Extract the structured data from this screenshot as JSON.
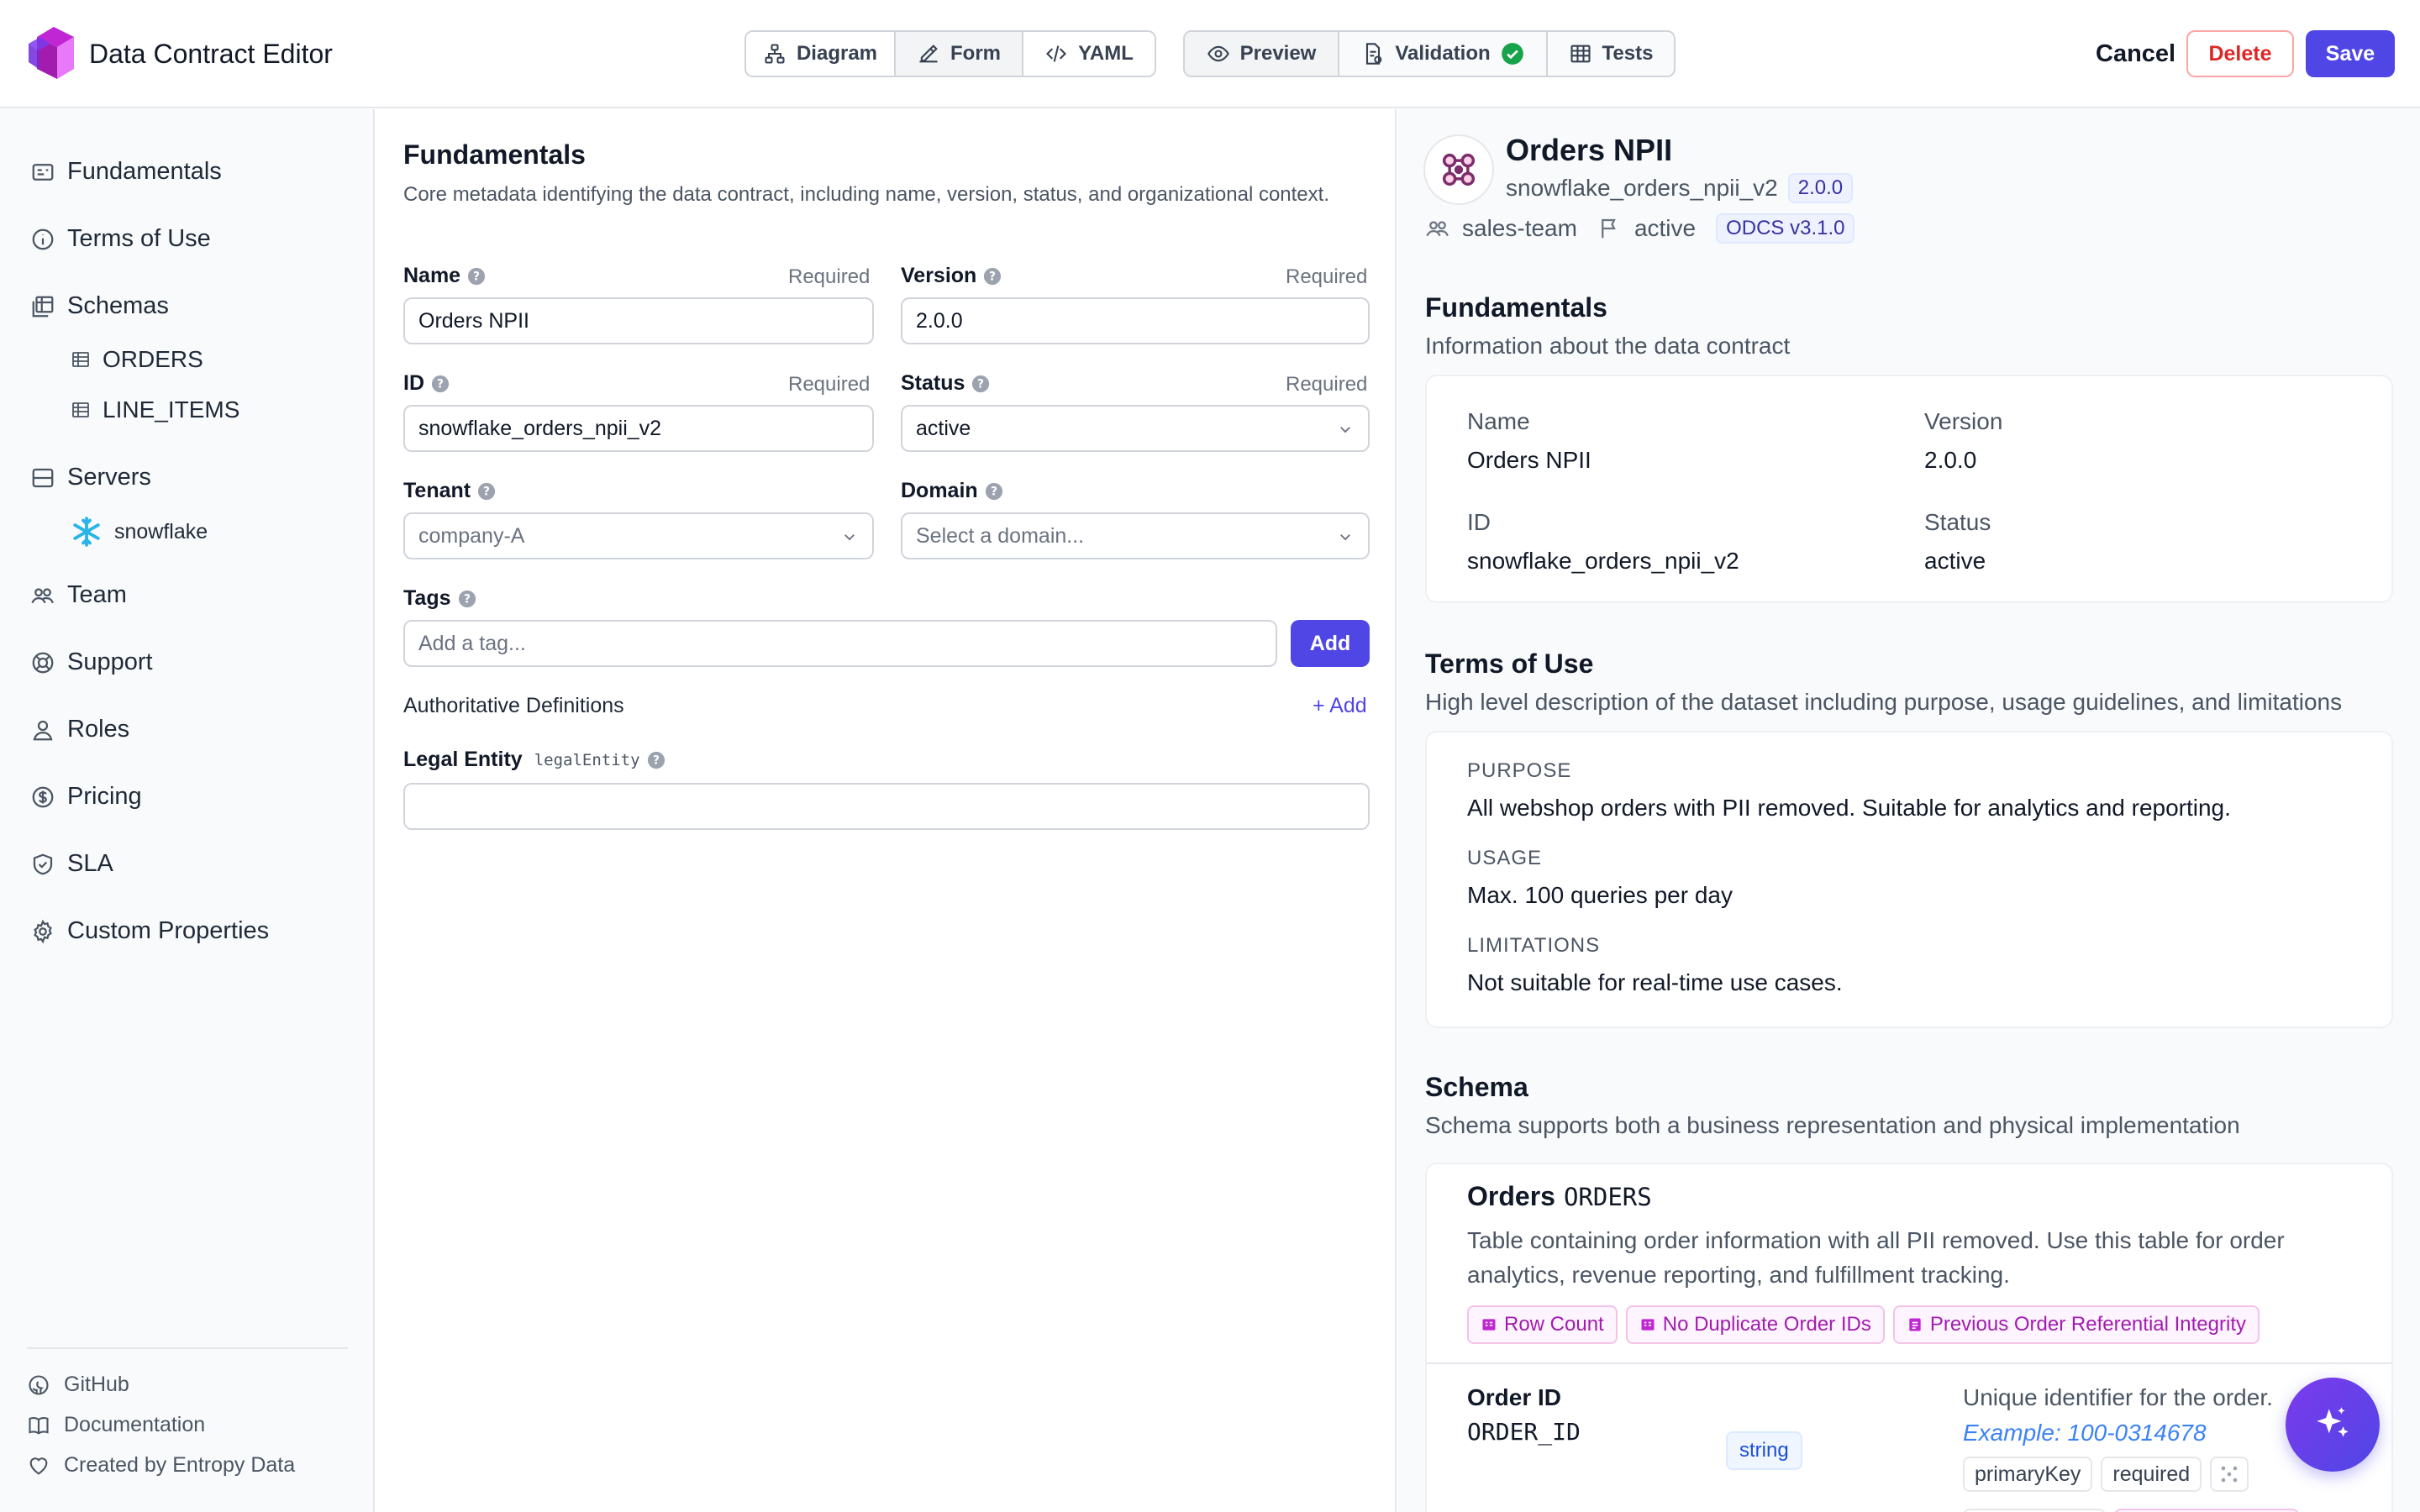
{
  "header": {
    "title": "Data Contract Editor",
    "views": [
      "Diagram",
      "Form",
      "YAML"
    ],
    "tools": [
      "Preview",
      "Validation",
      "Tests"
    ],
    "cancel": "Cancel",
    "delete": "Delete",
    "save": "Save",
    "colors": {
      "primary": "#4f46e5",
      "danger": "#dc2626",
      "success": "#16a34a"
    }
  },
  "sidebar": {
    "items": [
      {
        "label": "Fundamentals",
        "icon": "id-card-icon"
      },
      {
        "label": "Terms of Use",
        "icon": "info-icon"
      },
      {
        "label": "Schemas",
        "icon": "table-stack-icon"
      },
      {
        "label": "Servers",
        "icon": "server-icon"
      },
      {
        "label": "Team",
        "icon": "team-icon"
      },
      {
        "label": "Support",
        "icon": "lifebuoy-icon"
      },
      {
        "label": "Roles",
        "icon": "user-icon"
      },
      {
        "label": "Pricing",
        "icon": "dollar-icon"
      },
      {
        "label": "SLA",
        "icon": "shield-check-icon"
      },
      {
        "label": "Custom Properties",
        "icon": "gear-icon"
      }
    ],
    "schemas": [
      "ORDERS",
      "LINE_ITEMS"
    ],
    "servers": [
      "snowflake"
    ],
    "footer": [
      "GitHub",
      "Documentation",
      "Created by Entropy Data"
    ]
  },
  "form": {
    "title": "Fundamentals",
    "description": "Core metadata identifying the data contract, including name, version, status, and organizational context.",
    "required": "Required",
    "name_label": "Name",
    "name_value": "Orders NPII",
    "version_label": "Version",
    "version_value": "2.0.0",
    "id_label": "ID",
    "id_value": "snowflake_orders_npii_v2",
    "status_label": "Status",
    "status_value": "active",
    "tenant_label": "Tenant",
    "tenant_value": "company-A",
    "domain_label": "Domain",
    "domain_placeholder": "Select a domain...",
    "tags_label": "Tags",
    "tags_placeholder": "Add a tag...",
    "tags_add": "Add",
    "auth_defs_label": "Authoritative Definitions",
    "auth_defs_add": "+ Add",
    "legal_label": "Legal Entity",
    "legal_key": "legalEntity",
    "legal_value": ""
  },
  "preview": {
    "title": "Orders NPII",
    "id": "snowflake_orders_npii_v2",
    "version": "2.0.0",
    "team": "sales-team",
    "status": "active",
    "spec": "ODCS v3.1.0",
    "fundamentals": {
      "title": "Fundamentals",
      "desc": "Information about the data contract",
      "name_label": "Name",
      "name": "Orders NPII",
      "version_label": "Version",
      "version": "2.0.0",
      "id_label": "ID",
      "id": "snowflake_orders_npii_v2",
      "status_label": "Status",
      "status": "active"
    },
    "terms": {
      "title": "Terms of Use",
      "desc": "High level description of the dataset including purpose, usage guidelines, and limitations",
      "purpose_label": "PURPOSE",
      "purpose": "All webshop orders with PII removed. Suitable for analytics and reporting.",
      "usage_label": "USAGE",
      "usage": "Max. 100 queries per day",
      "limitations_label": "LIMITATIONS",
      "limitations": "Not suitable for real-time use cases."
    },
    "schema": {
      "title": "Schema",
      "desc": "Schema supports both a business representation and physical implementation",
      "table_name": "Orders",
      "table_physical": "ORDERS",
      "table_desc": "Table containing order information with all PII removed. Use this table for order analytics, revenue reporting, and fulfillment tracking.",
      "quality": [
        "Row Count",
        "No Duplicate Order IDs",
        "Previous Order Referential Integrity"
      ],
      "column": {
        "name": "Order ID",
        "physical": "ORDER_ID",
        "type": "string",
        "desc": "Unique identifier for the order.",
        "example": "Example: 100-0314678",
        "chips": [
          "primaryKey",
          "required"
        ]
      }
    }
  }
}
